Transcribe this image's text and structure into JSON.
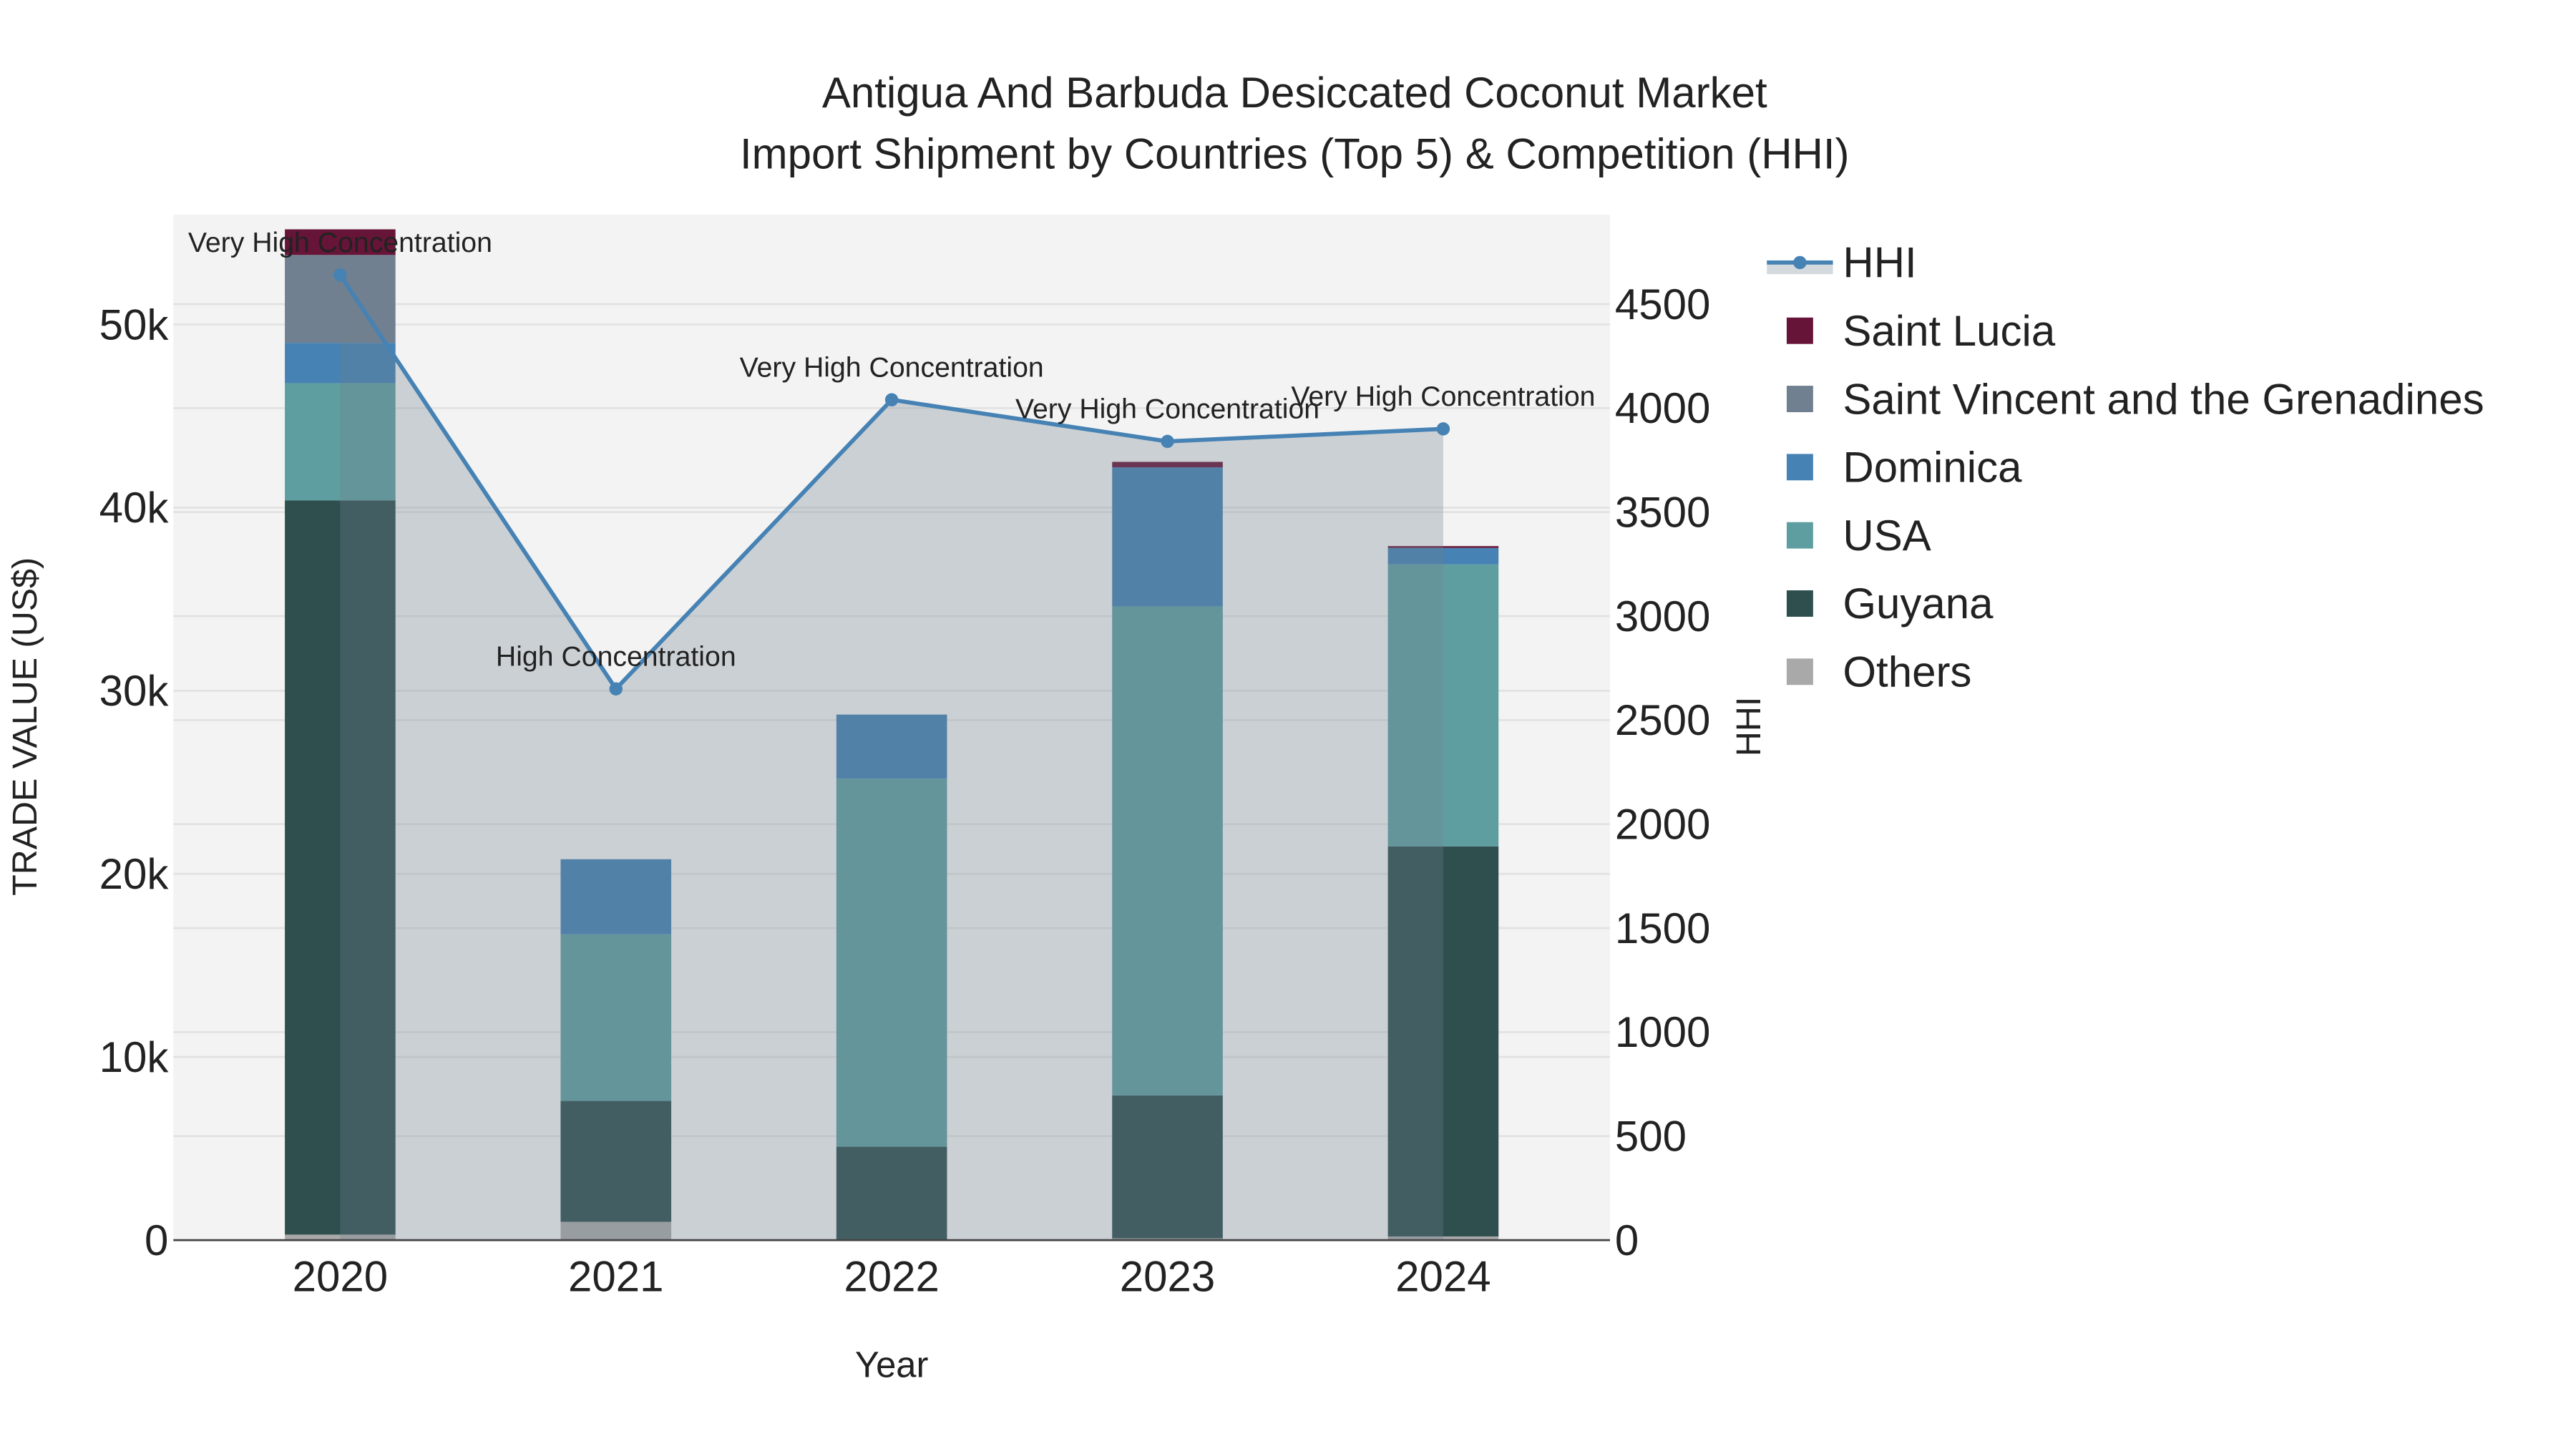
{
  "chart_data": {
    "type": "bar",
    "title_line1": "Antigua And Barbuda Desiccated Coconut Market",
    "title_line2": "Import Shipment by Countries (Top 5) & Competition (HHI)",
    "xlabel": "Year",
    "ylabel": "TRADE VALUE (US$)",
    "y2label": "HHI",
    "categories": [
      "2020",
      "2021",
      "2022",
      "2023",
      "2024"
    ],
    "ylim": [
      0,
      56000
    ],
    "y2lim": [
      0,
      4930
    ],
    "yticks": [
      {
        "v": 0,
        "label": "0"
      },
      {
        "v": 10000,
        "label": "10k"
      },
      {
        "v": 20000,
        "label": "20k"
      },
      {
        "v": 30000,
        "label": "30k"
      },
      {
        "v": 40000,
        "label": "40k"
      },
      {
        "v": 50000,
        "label": "50k"
      }
    ],
    "y2ticks": [
      0,
      500,
      1000,
      1500,
      2000,
      2500,
      3000,
      3500,
      4000,
      4500
    ],
    "series": [
      {
        "name": "Others",
        "color": "#a9a9a9",
        "values": [
          300,
          1000,
          0,
          100,
          200
        ]
      },
      {
        "name": "Guyana",
        "color": "#2f4f4f",
        "values": [
          40100,
          6600,
          5100,
          7800,
          21300
        ]
      },
      {
        "name": "USA",
        "color": "#5f9ea0",
        "values": [
          6400,
          9100,
          20100,
          26700,
          15400
        ]
      },
      {
        "name": "Dominica",
        "color": "#4682b4",
        "values": [
          2200,
          4100,
          3500,
          7600,
          900
        ]
      },
      {
        "name": "Saint Vincent and the Grenadines",
        "color": "#708090",
        "values": [
          4800,
          0,
          0,
          0,
          0
        ]
      },
      {
        "name": "Saint Lucia",
        "color": "#661538",
        "values": [
          1400,
          0,
          0,
          300,
          100
        ]
      }
    ],
    "hhi": {
      "name": "HHI",
      "color": "#4682b4",
      "values": [
        4640,
        2650,
        4040,
        3840,
        3900
      ],
      "annotations": [
        "Very High Concentration",
        "High Concentration",
        "Very High Concentration",
        "Very High Concentration",
        "Very High Concentration"
      ]
    },
    "legend_order": [
      "HHI",
      "Saint Lucia",
      "Saint Vincent and the Grenadines",
      "Dominica",
      "USA",
      "Guyana",
      "Others"
    ],
    "legend_placement": "right",
    "grid": true
  }
}
